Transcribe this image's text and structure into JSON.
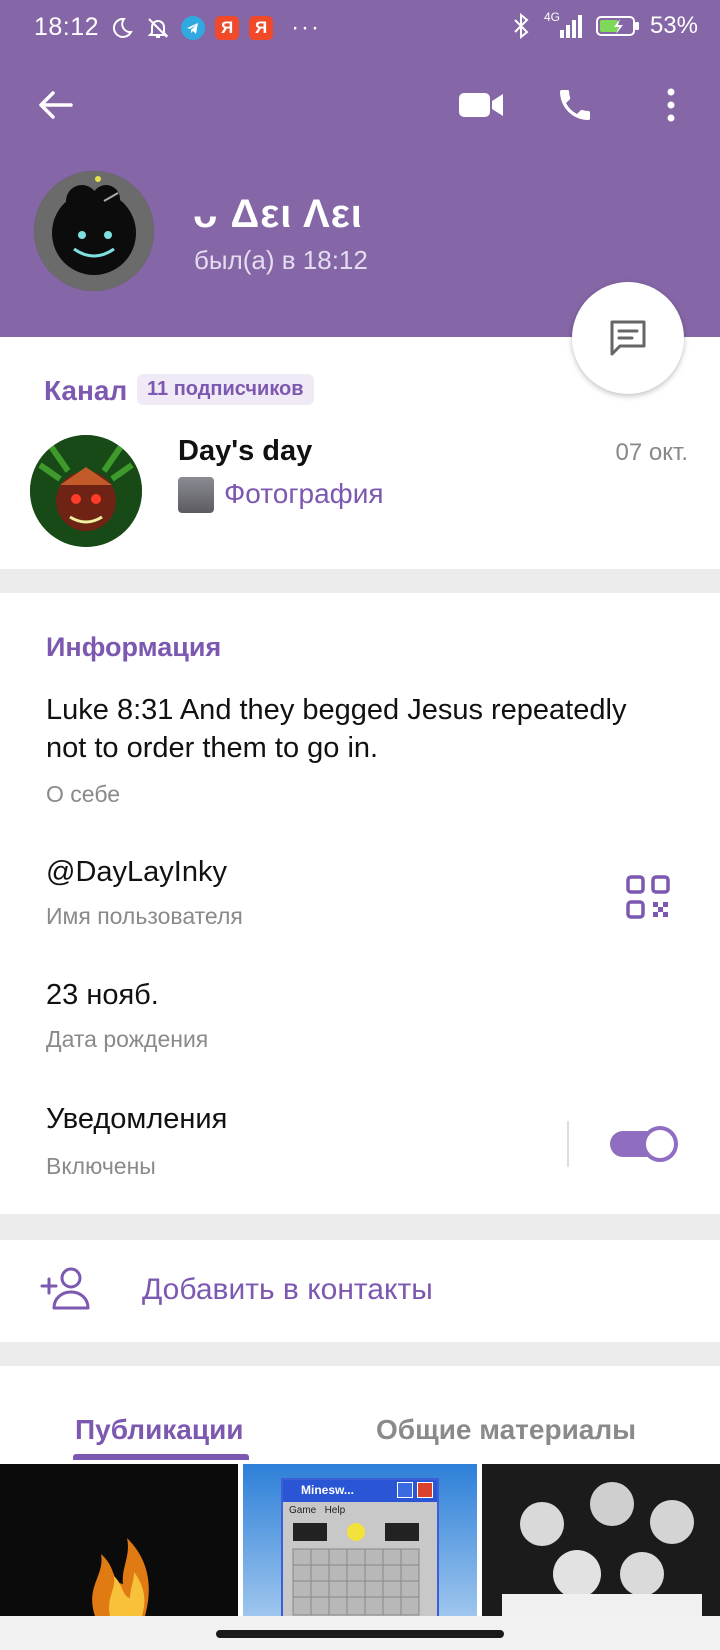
{
  "status_bar": {
    "time": "18:12",
    "ya_badge_1": "Я",
    "ya_badge_2": "Я",
    "more": "···",
    "network": "4G",
    "battery": "53%"
  },
  "profile": {
    "name": "ᴗ Δει Λει",
    "last_seen": "был(а) в 18:12"
  },
  "channel": {
    "label": "Канал",
    "subscribers": "11 подписчиков",
    "title": "Day's day",
    "date": "07 окт.",
    "preview": "Фотография"
  },
  "info": {
    "title": "Информация",
    "bio": "Luke 8:31 And they begged Jesus repeatedly not to order them to go in.",
    "bio_caption": "О себе",
    "username": "@DayLayInky",
    "username_caption": "Имя пользователя",
    "birthday": "23 нояб.",
    "birthday_caption": "Дата рождения",
    "notifications": "Уведомления",
    "notifications_status": "Включены",
    "notifications_enabled": true
  },
  "add_contact": {
    "label": "Добавить в контакты"
  },
  "tabs": {
    "posts": "Публикации",
    "shared": "Общие материалы",
    "active": "posts"
  },
  "media": {
    "minesweeper_title": "Minesw...",
    "minesweeper_menu_game": "Game",
    "minesweeper_menu_help": "Help"
  },
  "colors": {
    "header": "#8566a6",
    "accent": "#7c58b0",
    "toggle": "#8f6dc0"
  }
}
